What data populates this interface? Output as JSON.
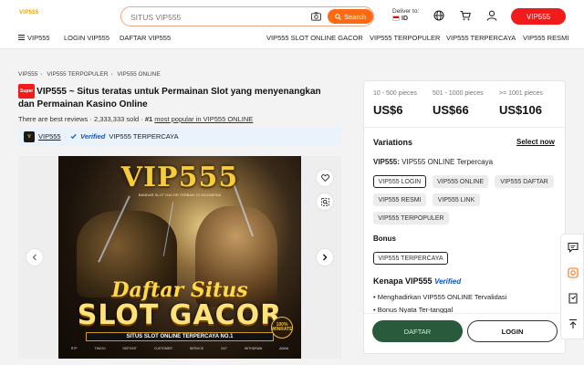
{
  "header": {
    "logo_text": "VIP555",
    "search_placeholder": "SITUS VIP555",
    "search_button": "Search",
    "deliver_label": "Deliver to:",
    "deliver_country": "ID",
    "top_button": "VIP555"
  },
  "nav": {
    "menu_label": "VIP555",
    "left_links": [
      "LOGIN VIP555",
      "DAFTAR VIP555"
    ],
    "right_links": [
      "VIP555 SLOT ONLINE GACOR",
      "VIP555 TERPOPULER",
      "VIP555 TERPERCAYA",
      "VIP555 RESMI"
    ]
  },
  "breadcrumb": [
    "VIP555",
    "VIP555 TERPOPULER",
    "VIP555 ONLINE"
  ],
  "product": {
    "badge": "Super",
    "title": "VIP555 ~ Situs teratas untuk Permainan Slot yang menyenangkan dan Permainan Kasino Online",
    "reviews_text": "There are best reviews · 2,333,333 sold ·",
    "rank": "#1",
    "rank_text": "most popular in VIP555 ONLINE",
    "store_name": "VIP555",
    "verified": "Verified",
    "store_tag": "VIP555 TERPERCAYA"
  },
  "banner": {
    "title": "VIP555",
    "subtitle": "BANDAR SLOT GACOR TERBAIK DI INDONESIA",
    "line1": "Daftar Situs",
    "line2": "SLOT GACOR",
    "ribbon": "SITUS SLOT ONLINE TERPERCAYA NO.1",
    "features": "RTP TINGGI   DEPOSIT   CUSTOMER SERVICE 24/7   WITHDRAW AMAN",
    "seal": "100% WINRATE"
  },
  "pricing": [
    {
      "range": "10 - 500 pieces",
      "price": "US$6"
    },
    {
      "range": "501 - 1000 pieces",
      "price": "US$66"
    },
    {
      "range": ">= 1001 pieces",
      "price": "US$106"
    }
  ],
  "variations": {
    "heading": "Variations",
    "select_now": "Select now",
    "label_bold": "VIP555:",
    "label_value": "VIP555 ONLINE Terpercaya",
    "options": [
      "VIP555 LOGIN",
      "VIP555 ONLINE",
      "VIP555 DAFTAR",
      "VIP555 RESMI",
      "VIP555 LINK",
      "VIP555 TERPOPULER"
    ],
    "selected_option": "VIP555 LOGIN",
    "bonus_label": "Bonus",
    "bonus_option": "VIP555 TERPERCAYA"
  },
  "why": {
    "heading": "Kenapa VIP555",
    "verified": "Verified",
    "bullets": [
      "Menghadirkan VIP555 ONLINE Tervalidasi",
      "Bonus Nyata Ter-tanggal"
    ]
  },
  "actions": {
    "primary": "DAFTAR",
    "secondary": "LOGIN"
  },
  "colors": {
    "accent": "#ff6a13",
    "brand_red": "#f21b1b",
    "primary_button": "#2a5a3c"
  }
}
